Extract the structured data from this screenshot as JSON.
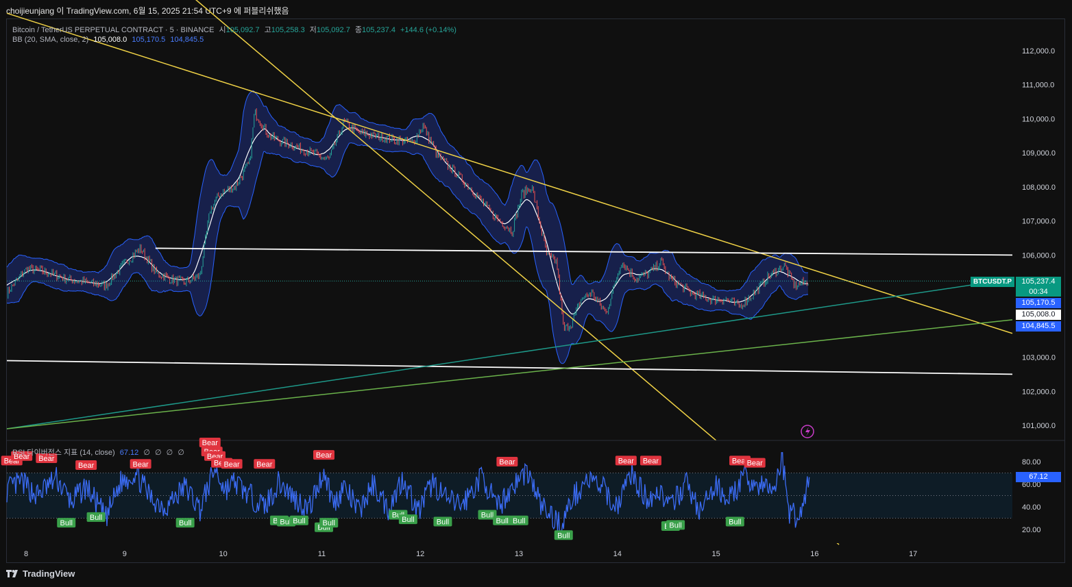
{
  "header": {
    "published_by": "choijieunjang 이 TradingView.com, 6월 15, 2025 21:54 UTC+9 에 퍼블리쉬했음"
  },
  "legend": {
    "symbol": "Bitcoin / TetherUS PERPETUAL CONTRACT · 5 · BINANCE",
    "open_label": "시",
    "open": "105,092.7",
    "high_label": "고",
    "high": "105,258.3",
    "low_label": "저",
    "low": "105,092.7",
    "close_label": "종",
    "close": "105,237.4",
    "change": "+144.6 (+0.14%)",
    "bb_label": "BB (20, SMA, close, 2)",
    "bb_basis": "105,008.0",
    "bb_upper": "105,170.5",
    "bb_lower": "104,845.5",
    "rsi_label": "RSI 다이버전스 지표 (14, close)",
    "rsi_value": "67.12",
    "rsi_toggles": [
      "∅",
      "∅",
      "∅",
      "∅"
    ]
  },
  "price_axis": {
    "symbol_tag": "BTCUSDT.P",
    "last_price": "105,237.4",
    "countdown": "00:34",
    "bb_upper_tag": "105,170.5",
    "bb_basis_tag": "105,008.0",
    "bb_lower_tag": "104,845.5",
    "rsi_tag": "67.12"
  },
  "footer": {
    "brand": "TradingView"
  },
  "colors": {
    "background": "#101010",
    "up": "#26a69a",
    "down": "#ef5350",
    "bb_band": "#2962ff",
    "trendline_yellow": "#f0d246",
    "horizontal_white": "#ffffff",
    "rising_teal": "#1e9a8a",
    "rising_green": "#6bb34b",
    "rsi_line": "#3b6cf5",
    "bear_label": "#e0343f",
    "bull_label": "#3aa04a"
  },
  "chart_data": [
    {
      "type": "line",
      "title": "Bitcoin / TetherUS PERPETUAL CONTRACT · 5 · BINANCE",
      "x_tick_labels": [
        "8",
        "9",
        "10",
        "11",
        "12",
        "13",
        "14",
        "15",
        "16",
        "17"
      ],
      "y_tick_labels": [
        "112,000.0",
        "111,000.0",
        "110,000.0",
        "109,000.0",
        "108,000.0",
        "107,000.0",
        "106,000.0",
        "103,000.0",
        "102,000.0",
        "101,000.0"
      ],
      "ylim": [
        100500,
        112800
      ],
      "xlim": [
        7.8,
        17.95
      ],
      "grid": false,
      "series": [
        {
          "kind": "price",
          "x": [
            7.8,
            8.0,
            8.2,
            8.4,
            8.6,
            8.8,
            9.0,
            9.15,
            9.3,
            9.45,
            9.6,
            9.75,
            9.85,
            9.95,
            10.1,
            10.25,
            10.3,
            10.45,
            10.6,
            10.8,
            10.95,
            11.05,
            11.2,
            11.35,
            11.5,
            11.7,
            11.9,
            12.0,
            12.15,
            12.3,
            12.5,
            12.7,
            12.9,
            13.0,
            13.1,
            13.25,
            13.35,
            13.42,
            13.5,
            13.6,
            13.7,
            13.85,
            14.0,
            14.15,
            14.3,
            14.4,
            14.5,
            14.7,
            14.9,
            15.05,
            15.2,
            15.35,
            15.5,
            15.6,
            15.65,
            15.75,
            15.9
          ],
          "y": [
            104900,
            105600,
            105500,
            105300,
            105200,
            105100,
            105800,
            106200,
            105500,
            105300,
            105200,
            105400,
            107300,
            107800,
            108000,
            108700,
            110200,
            109500,
            109300,
            109100,
            108900,
            108800,
            109900,
            109600,
            109500,
            109400,
            109300,
            109800,
            108900,
            108500,
            107900,
            107200,
            106700,
            107800,
            108000,
            106000,
            105800,
            103800,
            104000,
            104700,
            104900,
            104300,
            105800,
            105300,
            105500,
            105800,
            105300,
            104900,
            104700,
            104700,
            104500,
            104900,
            105400,
            105600,
            105700,
            105100,
            105237
          ]
        },
        {
          "kind": "bollinger",
          "basis": "105,008.0",
          "upper": "105,170.5",
          "lower": "104,845.5"
        },
        {
          "kind": "trendlines",
          "lines": [
            {
              "color": "yellow",
              "from": [
                7.8,
                113100
              ],
              "to": [
                17.95,
                103700
              ]
            },
            {
              "color": "yellow",
              "from": [
                9.3,
                114500
              ],
              "to": [
                16.2,
                97500
              ]
            },
            {
              "color": "white",
              "from": [
                9.3,
                106200
              ],
              "to": [
                17.95,
                106000
              ]
            },
            {
              "color": "white",
              "from": [
                7.8,
                102900
              ],
              "to": [
                17.95,
                102500
              ]
            },
            {
              "color": "teal",
              "from": [
                7.8,
                100900
              ],
              "to": [
                17.95,
                105300
              ]
            },
            {
              "color": "green",
              "from": [
                7.8,
                100900
              ],
              "to": [
                17.95,
                104100
              ]
            }
          ]
        }
      ]
    },
    {
      "type": "line",
      "title": "RSI 다이버전스 지표 (14, close)",
      "y_tick_labels": [
        "80.00",
        "60.00",
        "40.00",
        "20.00"
      ],
      "ylim": [
        15,
        90
      ],
      "levels": [
        70,
        50,
        30
      ],
      "series": [
        {
          "name": "RSI",
          "x": [
            7.8,
            7.95,
            8.1,
            8.3,
            8.45,
            8.6,
            8.8,
            8.95,
            9.1,
            9.25,
            9.4,
            9.6,
            9.75,
            9.9,
            10.0,
            10.1,
            10.25,
            10.4,
            10.55,
            10.7,
            10.85,
            11.0,
            11.1,
            11.2,
            11.35,
            11.5,
            11.65,
            11.8,
            11.95,
            12.1,
            12.25,
            12.4,
            12.6,
            12.75,
            12.9,
            13.05,
            13.2,
            13.3,
            13.4,
            13.5,
            13.65,
            13.8,
            13.95,
            14.1,
            14.25,
            14.4,
            14.5,
            14.65,
            14.8,
            14.95,
            15.1,
            15.25,
            15.4,
            15.55,
            15.62,
            15.7,
            15.8,
            15.9
          ],
          "y": [
            55,
            62,
            50,
            65,
            44,
            58,
            30,
            62,
            70,
            48,
            40,
            58,
            38,
            74,
            55,
            62,
            50,
            40,
            62,
            48,
            38,
            72,
            42,
            58,
            36,
            60,
            38,
            66,
            35,
            62,
            45,
            42,
            68,
            38,
            58,
            72,
            40,
            32,
            24,
            46,
            64,
            58,
            40,
            70,
            48,
            54,
            38,
            62,
            35,
            58,
            48,
            66,
            58,
            55,
            85,
            36,
            30,
            67.12
          ]
        }
      ],
      "annotations": [
        {
          "label": "Bear",
          "x": 7.85,
          "y": 81
        },
        {
          "label": "Bear",
          "x": 7.95,
          "y": 85
        },
        {
          "label": "Bear",
          "x": 8.2,
          "y": 83
        },
        {
          "label": "Bear",
          "x": 8.6,
          "y": 77
        },
        {
          "label": "Bear",
          "x": 9.15,
          "y": 78
        },
        {
          "label": "Bear",
          "x": 9.85,
          "y": 97
        },
        {
          "label": "Bear",
          "x": 9.87,
          "y": 89
        },
        {
          "label": "Bear",
          "x": 9.9,
          "y": 85
        },
        {
          "label": "Bear",
          "x": 9.97,
          "y": 79
        },
        {
          "label": "Bear",
          "x": 10.07,
          "y": 78
        },
        {
          "label": "Bear",
          "x": 10.4,
          "y": 78
        },
        {
          "label": "Bear",
          "x": 11.0,
          "y": 86
        },
        {
          "label": "Bear",
          "x": 12.85,
          "y": 80
        },
        {
          "label": "Bear",
          "x": 14.05,
          "y": 81
        },
        {
          "label": "Bear",
          "x": 14.3,
          "y": 81
        },
        {
          "label": "Bear",
          "x": 15.2,
          "y": 81
        },
        {
          "label": "Bear",
          "x": 15.35,
          "y": 79
        },
        {
          "label": "Bull",
          "x": 8.4,
          "y": 26
        },
        {
          "label": "Bull",
          "x": 8.7,
          "y": 31
        },
        {
          "label": "Bull",
          "x": 9.6,
          "y": 26
        },
        {
          "label": "Bull",
          "x": 10.55,
          "y": 28
        },
        {
          "label": "Bull",
          "x": 10.62,
          "y": 27
        },
        {
          "label": "Bull",
          "x": 10.75,
          "y": 28
        },
        {
          "label": "Bull",
          "x": 11.0,
          "y": 22
        },
        {
          "label": "Bull",
          "x": 11.05,
          "y": 26
        },
        {
          "label": "Bull",
          "x": 11.75,
          "y": 33
        },
        {
          "label": "Bull",
          "x": 11.85,
          "y": 29
        },
        {
          "label": "Bull",
          "x": 12.2,
          "y": 27
        },
        {
          "label": "Bull",
          "x": 12.65,
          "y": 33
        },
        {
          "label": "Bull",
          "x": 12.8,
          "y": 28
        },
        {
          "label": "Bull",
          "x": 12.97,
          "y": 28
        },
        {
          "label": "Bull",
          "x": 13.42,
          "y": 15
        },
        {
          "label": "Bull",
          "x": 14.5,
          "y": 23
        },
        {
          "label": "Bull",
          "x": 14.55,
          "y": 24
        },
        {
          "label": "Bull",
          "x": 15.15,
          "y": 27
        }
      ]
    }
  ]
}
